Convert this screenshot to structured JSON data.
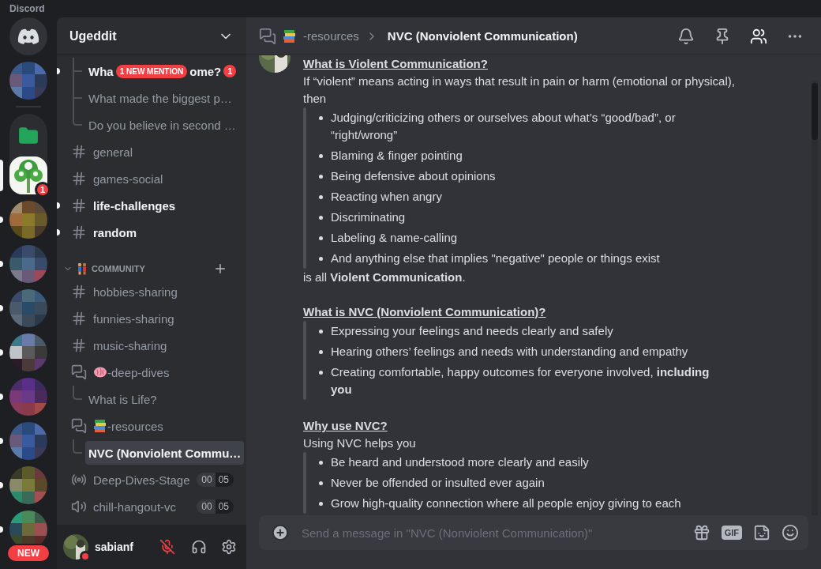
{
  "app_title": "Discord",
  "rail": {
    "items": [
      {
        "kind": "home",
        "unread": false,
        "selected": false
      },
      {
        "kind": "server",
        "unread": false,
        "selected": false
      },
      {
        "kind": "folder",
        "unread": false,
        "selected": false
      },
      {
        "kind": "tree",
        "unread": false,
        "selected": true,
        "badge": "1"
      },
      {
        "kind": "server",
        "unread": true,
        "selected": false
      },
      {
        "kind": "server",
        "unread": true,
        "selected": false
      },
      {
        "kind": "server",
        "unread": true,
        "selected": false
      },
      {
        "kind": "server",
        "unread": true,
        "selected": false
      },
      {
        "kind": "server",
        "unread": true,
        "selected": false
      },
      {
        "kind": "server",
        "unread": true,
        "selected": false
      },
      {
        "kind": "server",
        "unread": true,
        "selected": false
      },
      {
        "kind": "server",
        "unread": true,
        "selected": false
      }
    ],
    "new_badge": "NEW"
  },
  "sidebar": {
    "server_name": "Ugeddit",
    "mention_banner": "1 NEW MENTION",
    "channels": [
      {
        "kind": "thread",
        "name": "Wha",
        "name_end": "ome?",
        "unread": true,
        "selected": false,
        "mentions": "1",
        "last": false
      },
      {
        "kind": "thread",
        "name": "What made the biggest p…",
        "unread": false,
        "selected": false,
        "last": false
      },
      {
        "kind": "thread",
        "name": "Do you believe in second …",
        "unread": false,
        "selected": false,
        "last": true
      },
      {
        "kind": "text",
        "name": "general",
        "unread": false,
        "selected": false
      },
      {
        "kind": "text",
        "name": "games-social",
        "unread": false,
        "selected": false
      },
      {
        "kind": "text",
        "name": "life-challenges",
        "unread": true,
        "selected": false
      },
      {
        "kind": "text",
        "name": "random",
        "unread": true,
        "selected": false
      },
      {
        "kind": "category",
        "name": "COMMUNITY",
        "expanded": true
      },
      {
        "kind": "text",
        "name": "hobbies-sharing",
        "unread": false,
        "selected": false
      },
      {
        "kind": "text",
        "name": "funnies-sharing",
        "unread": false,
        "selected": false
      },
      {
        "kind": "text",
        "name": "music-sharing",
        "unread": false,
        "selected": false
      },
      {
        "kind": "forum",
        "name": "-deep-dives",
        "unread": false,
        "selected": false
      },
      {
        "kind": "thread",
        "name": "What is Life?",
        "unread": false,
        "selected": false,
        "last": true
      },
      {
        "kind": "forum",
        "name": "-resources",
        "unread": false,
        "selected": false
      },
      {
        "kind": "thread",
        "name": "NVC (Nonviolent Commu…",
        "unread": false,
        "selected": true,
        "last": true
      },
      {
        "kind": "stage",
        "name": "Deep-Dives-Stage",
        "users": "00",
        "limit": "05",
        "unread": false,
        "selected": false
      },
      {
        "kind": "voice",
        "name": "chill-hangout-vc",
        "users": "00",
        "limit": "05",
        "unread": false,
        "selected": false
      }
    ]
  },
  "user": {
    "name": "sabianf",
    "do_not_disturb": true,
    "muted": true
  },
  "header": {
    "forum_name": "-resources",
    "thread_title": "NVC (Nonviolent Communication)"
  },
  "message": {
    "blocks": [
      {
        "kind": "heading",
        "text": "What is Violent Communication?"
      },
      {
        "kind": "para",
        "text": "If “violent” means acting in ways that result in pain or harm (emotional or physical), then"
      },
      {
        "kind": "quote",
        "items": [
          "Judging/criticizing others or ourselves about what’s “good/bad”, or “right/wrong”",
          "Blaming & finger pointing",
          "Being defensive about opinions",
          "Reacting when angry",
          "Discriminating",
          "Labeling & name-calling",
          "And anything else that implies \"negative\" people or things exist"
        ]
      },
      {
        "kind": "para",
        "text": "is all **Violent Communication**."
      },
      {
        "kind": "heading",
        "text": "What is NVC (Nonviolent Communication)?"
      },
      {
        "kind": "quote",
        "items": [
          "Expressing your feelings and needs clearly and safely",
          "Hearing others’ feelings and needs with understanding and empathy",
          "Creating comfortable, happy outcomes for everyone involved, **including you**"
        ]
      },
      {
        "kind": "heading",
        "text": "Why use NVC?"
      },
      {
        "kind": "para",
        "text": "Using NVC helps you"
      },
      {
        "kind": "quote",
        "items": [
          "Be heard and understood more clearly and easily",
          "Never be offended or insulted ever again",
          "Grow high-quality connection where all people enjoy giving to each"
        ]
      }
    ]
  },
  "composer": {
    "placeholder": "Send a message in \"NVC (Nonviolent Communication)\"",
    "gif_label": "GIF"
  }
}
